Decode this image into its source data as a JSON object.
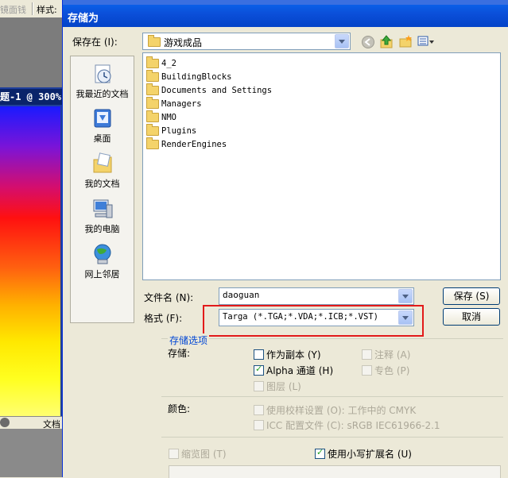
{
  "background_app": {
    "toolbar_left": "镜面钱",
    "toolbar_style_label": "样式:",
    "doc_title": "题-1 @ 300%",
    "status_label": "文档"
  },
  "dialog": {
    "title": "存储为",
    "save_in_label": "保存在 (I):",
    "save_in_value": "游戏成品",
    "toolbar_icons": [
      "back-icon",
      "up-folder-icon",
      "new-folder-icon",
      "view-menu-icon"
    ],
    "places": [
      {
        "label": "我最近的文档",
        "icon": "recent-documents-icon"
      },
      {
        "label": "桌面",
        "icon": "desktop-icon"
      },
      {
        "label": "我的文档",
        "icon": "my-documents-icon"
      },
      {
        "label": "我的电脑",
        "icon": "my-computer-icon"
      },
      {
        "label": "网上邻居",
        "icon": "network-places-icon"
      }
    ],
    "files": [
      "4_2",
      "BuildingBlocks",
      "Documents and Settings",
      "Managers",
      "NMO",
      "Plugins",
      "RenderEngines"
    ],
    "filename_label": "文件名 (N):",
    "filename_value": "daoguan",
    "format_label": "格式 (F):",
    "format_value": "Targa (*.TGA;*.VDA;*.ICB;*.VST)",
    "save_button": "保存 (S)",
    "cancel_button": "取消",
    "options": {
      "section_title": "存储选项",
      "store_label": "存储:",
      "as_copy": "作为副本 (Y)",
      "as_copy_checked": false,
      "notes": "注释 (A)",
      "alpha": "Alpha 通道 (H)",
      "alpha_checked": true,
      "spot": "专色 (P)",
      "layers": "图层 (L)",
      "color_label": "颜色:",
      "use_proof": "使用校样设置 (O): 工作中的 CMYK",
      "icc": "ICC 配置文件 (C): sRGB IEC61966-2.1",
      "thumbnail": "缩览图 (T)",
      "lowercase_ext": "使用小写扩展名 (U)",
      "lowercase_ext_checked": true
    }
  }
}
